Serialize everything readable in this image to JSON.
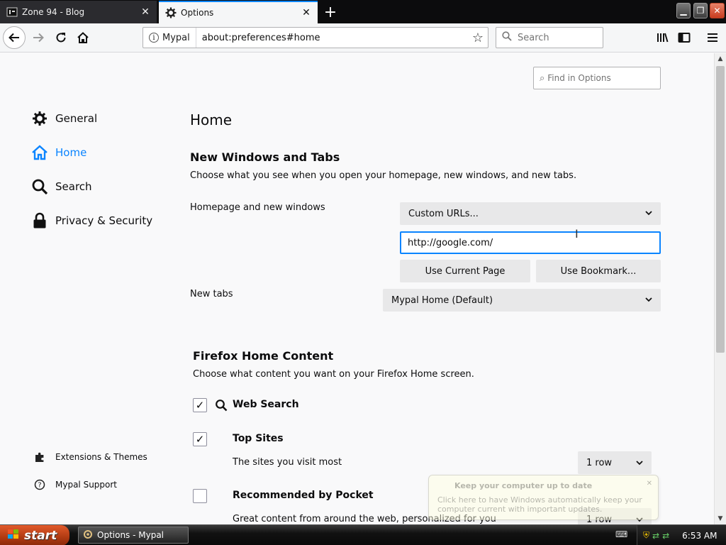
{
  "tabs": [
    {
      "title": "Zone 94 - Blog",
      "favicon": "zone94-favicon",
      "active": false
    },
    {
      "title": "Options",
      "favicon": "gear-icon",
      "active": true
    }
  ],
  "nav": {
    "identity_label": "Mypal",
    "url": "about:preferences#home",
    "search_placeholder": "Search"
  },
  "find_placeholder": "Find in Options",
  "categories": [
    {
      "label": "General",
      "icon": "gear-icon"
    },
    {
      "label": "Home",
      "icon": "home-icon",
      "selected": true
    },
    {
      "label": "Search",
      "icon": "search-icon"
    },
    {
      "label": "Privacy & Security",
      "icon": "lock-icon"
    }
  ],
  "footer_links": [
    {
      "label": "Extensions & Themes",
      "icon": "puzzle-icon"
    },
    {
      "label": "Mypal Support",
      "icon": "help-icon"
    }
  ],
  "page_title": "Home",
  "new_windows": {
    "title": "New Windows and Tabs",
    "desc": "Choose what you see when you open your homepage, new windows, and new tabs.",
    "homepage_label": "Homepage and new windows",
    "homepage_select": "Custom URLs...",
    "homepage_url": "http://google.com/",
    "use_current": "Use Current Page",
    "use_bookmark": "Use Bookmark...",
    "newtabs_label": "New tabs",
    "newtabs_select": "Mypal Home (Default)"
  },
  "home_content": {
    "title": "Firefox Home Content",
    "desc": "Choose what content you want on your Firefox Home screen.",
    "options": [
      {
        "label": "Web Search",
        "checked": true
      },
      {
        "label": "Top Sites",
        "checked": true,
        "desc": "The sites you visit most",
        "rows": "1 row"
      },
      {
        "label": "Recommended by Pocket",
        "checked": false,
        "desc": "Great content from around the web, personalized for you",
        "rows": "1 row"
      }
    ]
  },
  "balloon": {
    "title": "Keep your computer up to date",
    "body": "Click here to have Windows automatically keep your computer current with important updates."
  },
  "taskbar": {
    "start_label": "start",
    "task_label": "Options - Mypal",
    "clock": "6:53 AM"
  },
  "colors": {
    "accent": "#0a84ff",
    "start_button": "#c8461a"
  }
}
